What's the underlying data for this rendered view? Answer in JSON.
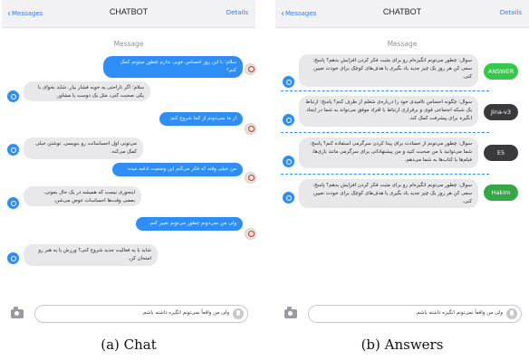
{
  "panel_a": {
    "header": {
      "back_label": "Messages",
      "title": "CHATBOT",
      "details_label": "Details"
    },
    "section_label": "Message",
    "messages": [
      {
        "sender": "user",
        "text": "سلام؛ با این روز احساس خوبی ندارم چطور میتونم کمک کنم؟"
      },
      {
        "sender": "bot",
        "text": "سلام؛ اگر ناراحتی یه خوبه فشار بیار. شاید بخوای با یکی صحبت کنی، مثل یک دوست یا مشاور."
      },
      {
        "sender": "user",
        "text": "از ما نمی‌دونم از کجا شروع کنم."
      },
      {
        "sender": "bot",
        "text": "می‌تونی اول احساساتت رو بنویسی. نوشتن خیلی کمک می‌کنه."
      },
      {
        "sender": "user",
        "text": "من خیلی وقته که فکر می‌کنم این وضعیت ادامه میده"
      },
      {
        "sender": "bot",
        "text": "اینجوری نیست که همیشه در یک حال بمونی. بعضی وقت‌ها احساسات عوض می‌شن."
      },
      {
        "sender": "user",
        "text": "ولی من نمی‌دونم چطور می‌تونم تغییر کنم."
      },
      {
        "sender": "bot",
        "text": "شاید با یه فعالیت جدید شروع کنی؟ ورزش یا یه هنر رو امتحان کن."
      }
    ],
    "composer": {
      "value": "ولی من واقعاً نمی‌تونم انگیزه داشته باشم."
    },
    "caption": "(a) Chat"
  },
  "panel_b": {
    "header": {
      "back_label": "Messages",
      "title": "CHATBOT",
      "details_label": "Details"
    },
    "section_label": "Message",
    "answers": [
      {
        "text": "سوال: چطور می‌تونم انگیزه‌ام رو برای مثبت فکر کردن افزایش بدهم؟ پاسخ: سعی کن هر روز یک چیز جدید یاد بگیری یا هدف‌های کوچک برای خودت تعیین کنی.",
        "model": "ANSWER",
        "color": "#35c84a"
      },
      {
        "text": "سوال: چگونه احساس ناامیدی خود را درباره‌ی شغلم از طرف کنم؟ پاسخ: ارتباط یک شبکه اجتماعی قوی و برقراری ارتباط با افراد موفق می‌تواند به شما در ایجاد انگیزه برای پیشرفت کمک کند.",
        "model": "Jina-v3",
        "color": "#3a3a3c"
      },
      {
        "text": "سوال: چطور می‌تونم از حسادت برای پیدا کردن سرگرمی استفاده کنم؟ پاسخ: شما می‌توانید با من صحبت کنید و من پیشنهاداتی برای سرگرمی مانند بازی‌ها، فیلم‌ها یا کتاب‌ها به شما می‌دهم.",
        "model": "E5",
        "color": "#3a3a3c"
      },
      {
        "text": "سوال: چطور می‌تونم انگیزه‌ام رو برای مثبت فکر کردن افزایش بدهم؟ پاسخ: سعی کن هر روز یک چیز جدید یاد بگیری یا هدف‌های کوچک برای خودت تعیین کنی.",
        "model": "Hakim",
        "color": "#35a845"
      }
    ],
    "composer": {
      "value": "ولی من واقعاً نمی‌تونم انگیزه داشته باشم."
    },
    "caption": "(b) Answers"
  },
  "icons": {
    "user_avatar": "user-avatar-icon",
    "bot_avatar": "bot-avatar-icon",
    "camera": "camera-icon",
    "mic": "mic-icon"
  }
}
